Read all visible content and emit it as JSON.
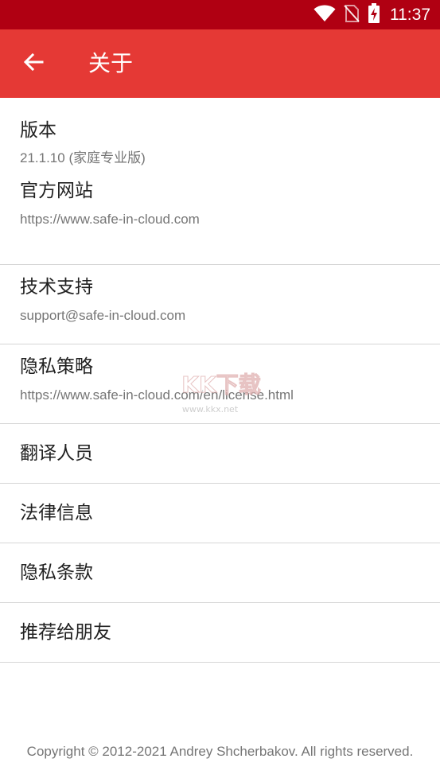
{
  "status_bar": {
    "time": "11:37",
    "icons": [
      "wifi-icon",
      "no-sim-icon",
      "battery-charging-icon"
    ]
  },
  "app_bar": {
    "title": "关于",
    "back_icon": "arrow-left-icon"
  },
  "items": [
    {
      "title": "版本",
      "subtitle": "21.1.10 (家庭专业版)"
    },
    {
      "title": "官方网站",
      "subtitle": "https://www.safe-in-cloud.com"
    },
    {
      "title": "技术支持",
      "subtitle": "support@safe-in-cloud.com"
    },
    {
      "title": "隐私策略",
      "subtitle": "https://www.safe-in-cloud.com/en/license.html"
    },
    {
      "title": "翻译人员"
    },
    {
      "title": "法律信息"
    },
    {
      "title": "隐私条款"
    },
    {
      "title": "推荐给朋友"
    }
  ],
  "watermark": {
    "logo_text": "KK下载",
    "url": "www.kkx.net"
  },
  "footer": {
    "copyright": "Copyright © 2012-2021 Andrey Shcherbakov. All rights reserved."
  },
  "colors": {
    "status_bar": "#b00012",
    "app_bar": "#e53935",
    "title_text": "#212121",
    "secondary_text": "#757575",
    "divider": "#d6d6d6"
  }
}
